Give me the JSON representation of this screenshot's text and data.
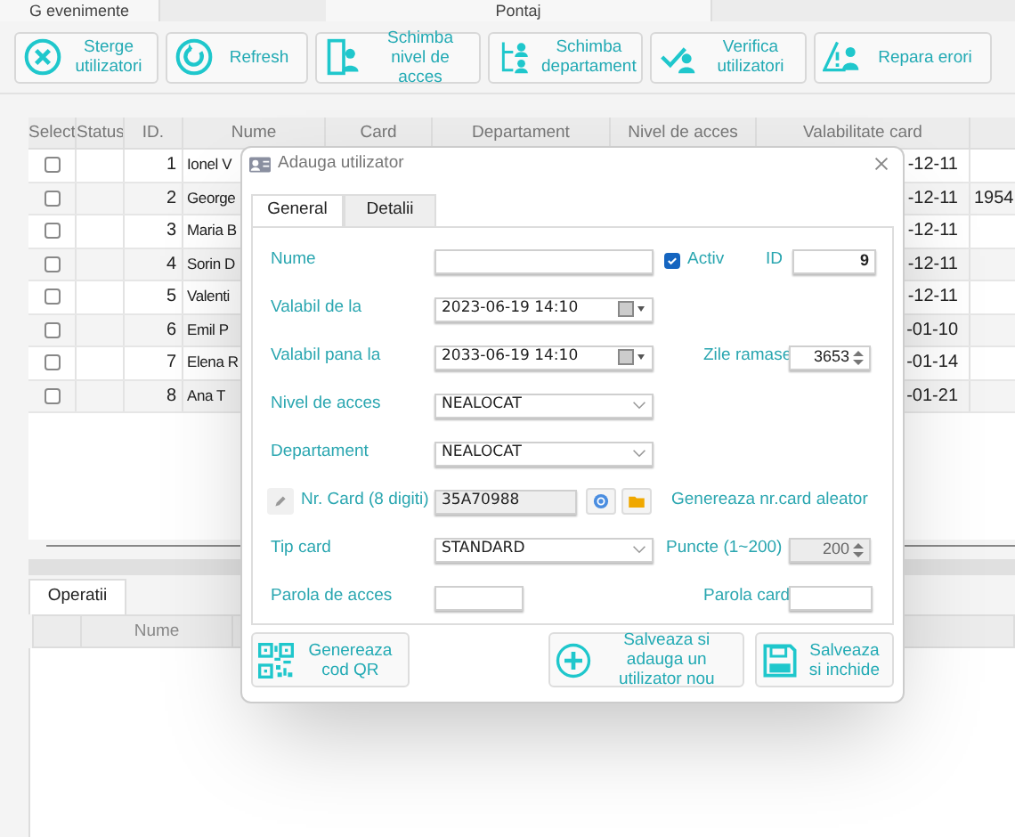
{
  "top_tabs": [
    {
      "label": "G evenimente"
    },
    {
      "label": "Pontaj"
    }
  ],
  "toolbar": [
    {
      "label": "Sterge utilizatori"
    },
    {
      "label": "Refresh"
    },
    {
      "label": "Schimba nivel de acces"
    },
    {
      "label": "Schimba departament"
    },
    {
      "label": "Verifica utilizatori"
    },
    {
      "label": "Repara erori"
    }
  ],
  "users_table": {
    "columns": [
      "Select",
      "Status",
      "ID.",
      "Nume",
      "Card",
      "Departament",
      "Nivel de acces",
      "Valabilitate card"
    ],
    "rows": [
      {
        "checked": false,
        "id": "1",
        "name": "Ionel V",
        "validity": "-12-11"
      },
      {
        "checked": false,
        "id": "2",
        "name": "George",
        "validity": "-12-11",
        "column_9": "1954"
      },
      {
        "checked": false,
        "id": "3",
        "name": "Maria B",
        "validity": "-12-11"
      },
      {
        "checked": false,
        "id": "4",
        "name": "Sorin D",
        "validity": "-12-11"
      },
      {
        "checked": false,
        "id": "5",
        "name": "Valenti",
        "validity": "-12-11"
      },
      {
        "checked": false,
        "id": "6",
        "name": "Emil P",
        "validity": "-01-10"
      },
      {
        "checked": false,
        "id": "7",
        "name": "Elena R",
        "validity": "-01-14"
      },
      {
        "checked": false,
        "id": "8",
        "name": "Ana T",
        "validity": "-01-21"
      }
    ]
  },
  "bottom_tabs": [
    {
      "label": "Operatii",
      "selected": true
    }
  ],
  "operations_table": {
    "columns": [
      "Nume"
    ]
  },
  "dialog": {
    "title": "Adauga utilizator",
    "tabs": [
      {
        "label": "General",
        "selected": true
      },
      {
        "label": "Detalii",
        "selected": false
      }
    ],
    "name_label": "Nume",
    "active": {
      "label": "Activ",
      "checked": true
    },
    "id": {
      "label": "ID",
      "value": "9"
    },
    "valid_from": {
      "label": "Valabil de la",
      "value": "2023-06-19 14:10"
    },
    "valid_to": {
      "label": "Valabil pana la",
      "value": "2033-06-19 14:10"
    },
    "days_left": {
      "label": "Zile ramase",
      "value": "3653"
    },
    "access_level": {
      "label": "Nivel de acces",
      "value": "NEALOCAT"
    },
    "department": {
      "label": "Departament",
      "value": "NEALOCAT"
    },
    "card_number": {
      "label": "Nr. Card (8 digiti)",
      "value": "35A70988",
      "generate_link": "Genereaza nr.card aleator"
    },
    "card_type": {
      "label": "Tip card",
      "value": "STANDARD"
    },
    "points": {
      "label": "Puncte (1~200)",
      "value": "200",
      "disabled": true
    },
    "access_password": {
      "label": "Parola de acces"
    },
    "card_password": {
      "label": "Parola card"
    },
    "buttons": [
      {
        "label": "Genereaza cod QR"
      },
      {
        "label": "Salveaza si adauga un utilizator nou"
      },
      {
        "label": "Salveaza si inchide"
      }
    ]
  }
}
